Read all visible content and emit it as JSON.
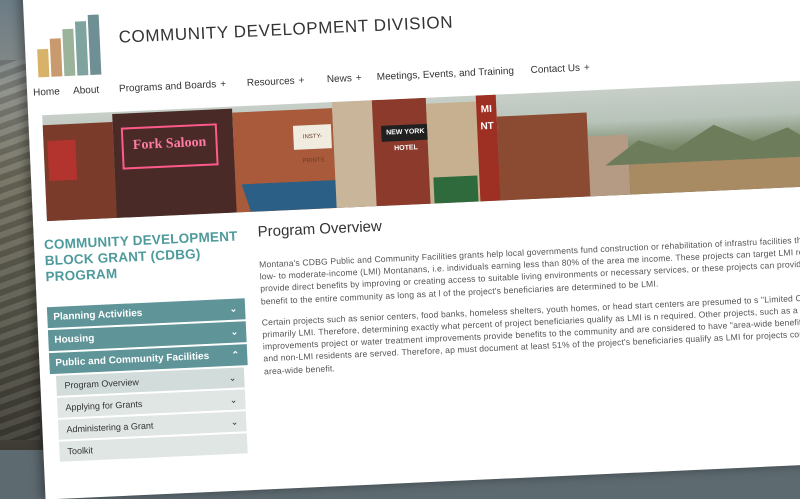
{
  "site": {
    "title": "COMMUNITY DEVELOPMENT DIVISION"
  },
  "nav": {
    "items": [
      {
        "label": "Home",
        "plus": ""
      },
      {
        "label": "About",
        "plus": ""
      },
      {
        "label": "Programs and Boards",
        "plus": "+"
      },
      {
        "label": "Resources",
        "plus": "+"
      },
      {
        "label": "News",
        "plus": "+"
      },
      {
        "label": "Meetings, Events, and Training",
        "plus": ""
      },
      {
        "label": "Contact Us",
        "plus": "+"
      }
    ]
  },
  "hero": {
    "signs": {
      "neon": "Fork Saloon",
      "cafe": "NEW YORK HOTEL",
      "mint": "MINT",
      "print": "INSTY-PRINTS"
    }
  },
  "sidebar": {
    "title": "COMMUNITY DEVELOPMENT BLOCK GRANT (CDBG) PROGRAM",
    "menu": [
      {
        "label": "Planning Activities",
        "chevron": "⌄"
      },
      {
        "label": "Housing",
        "chevron": "⌄"
      },
      {
        "label": "Public and Community Facilities",
        "chevron": "⌃"
      }
    ],
    "submenu": [
      {
        "label": "Program Overview",
        "chevron": "⌄"
      },
      {
        "label": "Applying for Grants",
        "chevron": "⌄"
      },
      {
        "label": "Administering a Grant",
        "chevron": "⌄"
      },
      {
        "label": "Toolkit",
        "chevron": ""
      }
    ]
  },
  "content": {
    "heading": "Program Overview",
    "paragraphs": [
      "Montana's CDBG Public and Community Facilities grants help local governments fund construction or rehabilitation of infrastru facilities that primarily benefit low- to moderate-income (LMI) Montanans, i.e. individuals earning less than 80% of the area me income. These projects can target LMI residents and provide direct benefits by improving or creating access to suitable living environments or necessary services, or these projects can provide an area-wide benefit to the entire community as long as at l of the project's beneficiaries are determined to be LMI.",
      "Certain projects such as senior centers, food banks, homeless shelters, youth homes, or head start centers are presumed to s \"Limited Clientele\" that is primarily LMI. Therefore, determining exactly what percent of project beneficiaries qualify as LMI is n required. Other projects, such as a wastewater improvements project or water treatment improvements provide benefits to the community and are considered to have \"area-wide benefit\" because both LMI and non-LMI residents are served. Therefore, ap must document at least 51% of the project's beneficiaries qualify as LMI for projects considered to have an area-wide benefit."
    ]
  },
  "colors": {
    "accent": "#5f9498",
    "title": "#4e9a9c",
    "logo": [
      "#d9b26a",
      "#c99a6e",
      "#9bb39a",
      "#7fa39e",
      "#6e8f93"
    ]
  }
}
